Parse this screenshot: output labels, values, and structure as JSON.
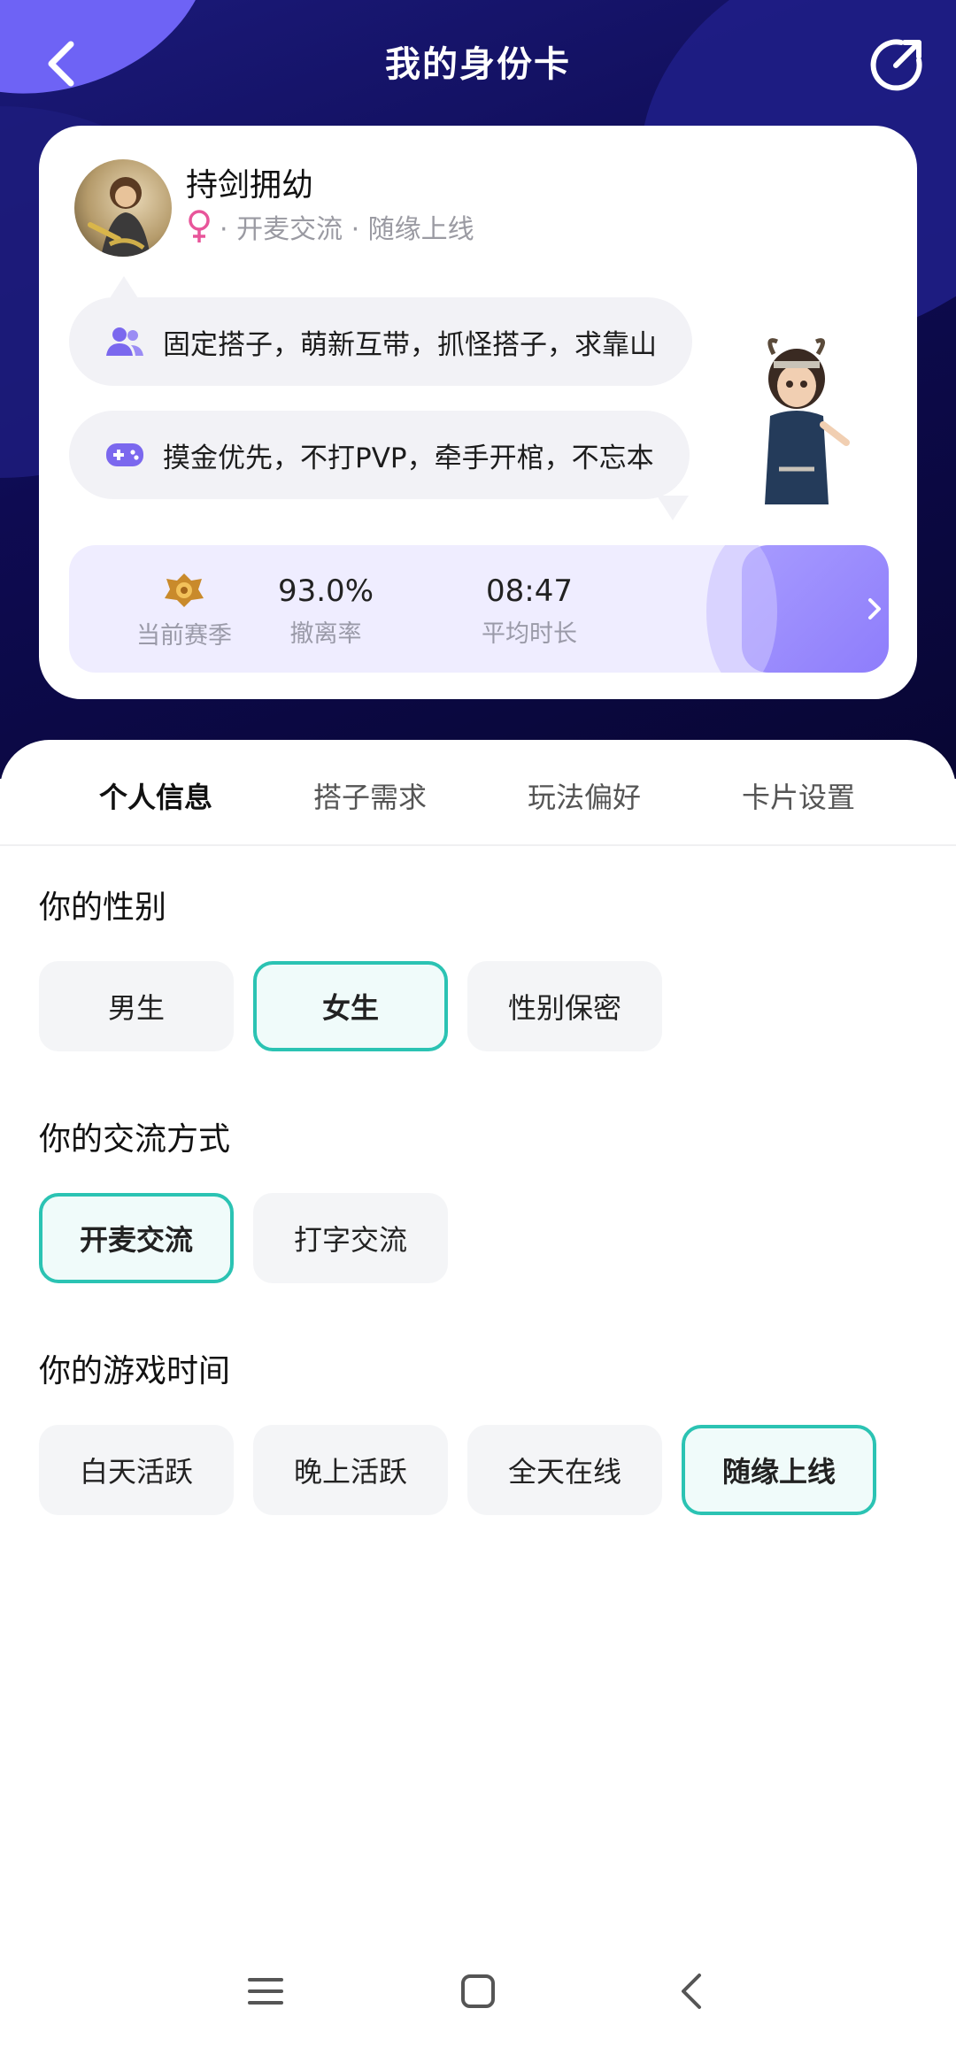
{
  "header": {
    "title": "我的身份卡"
  },
  "profile": {
    "nickname": "持剑拥幼",
    "meta": "· 开麦交流 · 随缘上线",
    "gender_icon": "female-icon"
  },
  "bubbles": [
    {
      "icon": "people-icon",
      "text": "固定搭子，萌新互带，抓怪搭子，求靠山"
    },
    {
      "icon": "gamepad-icon",
      "text": "摸金优先，不打PVP，牵手开棺，不忘本"
    }
  ],
  "stats": {
    "season_label": "当前赛季",
    "retreat_rate_value": "93.0%",
    "retreat_rate_label": "撤离率",
    "avg_duration_value": "08:47",
    "avg_duration_label": "平均时长"
  },
  "tabs": [
    "个人信息",
    "搭子需求",
    "玩法偏好",
    "卡片设置"
  ],
  "active_tab": "个人信息",
  "sections": {
    "gender": {
      "title": "你的性别",
      "options": [
        "男生",
        "女生",
        "性别保密"
      ],
      "selected": "女生"
    },
    "communication": {
      "title": "你的交流方式",
      "options": [
        "开麦交流",
        "打字交流"
      ],
      "selected": "开麦交流"
    },
    "playtime": {
      "title": "你的游戏时间",
      "options": [
        "白天活跃",
        "晚上活跃",
        "全天在线",
        "随缘上线"
      ],
      "selected": "随缘上线"
    }
  },
  "colors": {
    "hero_bg": "#0e0b52",
    "accent_teal": "#2bc3b3",
    "accent_purple": "#7b68ee",
    "female_pink": "#e8559a"
  }
}
